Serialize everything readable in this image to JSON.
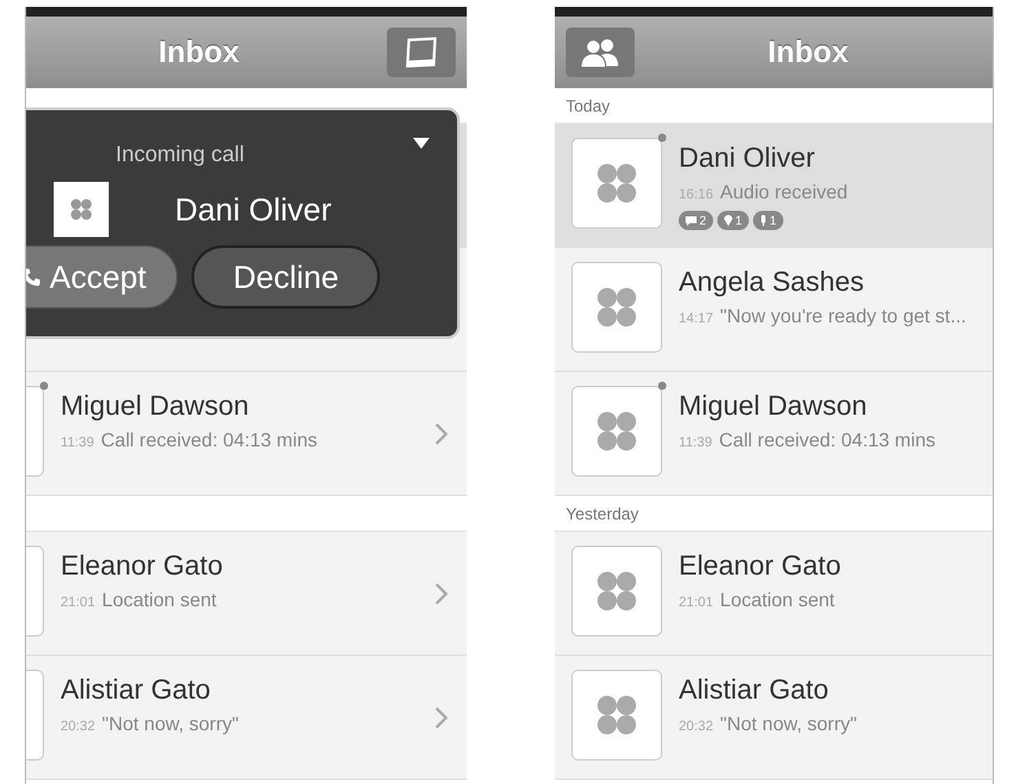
{
  "phones": [
    {
      "title": "Inbox",
      "header_button": {
        "kind": "compose"
      },
      "show_chevrons": true,
      "incoming_call": {
        "label": "Incoming call",
        "caller": "Dani Oliver",
        "accept": "Accept",
        "decline": "Decline"
      },
      "sections": [
        {
          "rows": [
            {
              "kind": "covered",
              "selected": true
            },
            {
              "kind": "covered",
              "selected": false
            },
            {
              "kind": "contact",
              "selected": false,
              "unread": true,
              "name": "Miguel Dawson",
              "time": "11:39",
              "preview": "Call received: 04:13 mins"
            }
          ]
        },
        {
          "rows": [
            {
              "kind": "contact",
              "selected": false,
              "unread": false,
              "name": "Eleanor Gato",
              "time": "21:01",
              "preview": "Location sent"
            },
            {
              "kind": "contact",
              "selected": false,
              "unread": false,
              "name": "Alistiar Gato",
              "time": "20:32",
              "preview": "\"Not now, sorry\""
            }
          ]
        }
      ]
    },
    {
      "title": "Inbox",
      "header_button": {
        "kind": "contacts"
      },
      "show_chevrons": false,
      "sections": [
        {
          "title": "Today",
          "rows": [
            {
              "kind": "contact",
              "selected": true,
              "unread": true,
              "name": "Dani Oliver",
              "time": "16:16",
              "preview": "Audio received",
              "badges": [
                {
                  "kind": "message",
                  "count": "2"
                },
                {
                  "kind": "location",
                  "count": "1"
                },
                {
                  "kind": "audio",
                  "count": "1"
                }
              ]
            },
            {
              "kind": "contact",
              "selected": false,
              "unread": false,
              "name": "Angela Sashes",
              "time": "14:17",
              "preview": "\"Now you're ready to get st..."
            },
            {
              "kind": "contact",
              "selected": false,
              "unread": true,
              "name": "Miguel Dawson",
              "time": "11:39",
              "preview": "Call received: 04:13 mins"
            }
          ]
        },
        {
          "title": "Yesterday",
          "rows": [
            {
              "kind": "contact",
              "selected": false,
              "unread": false,
              "name": "Eleanor Gato",
              "time": "21:01",
              "preview": "Location sent"
            },
            {
              "kind": "contact",
              "selected": false,
              "unread": false,
              "name": "Alistiar Gato",
              "time": "20:32",
              "preview": "\"Not now, sorry\""
            }
          ]
        }
      ]
    }
  ]
}
